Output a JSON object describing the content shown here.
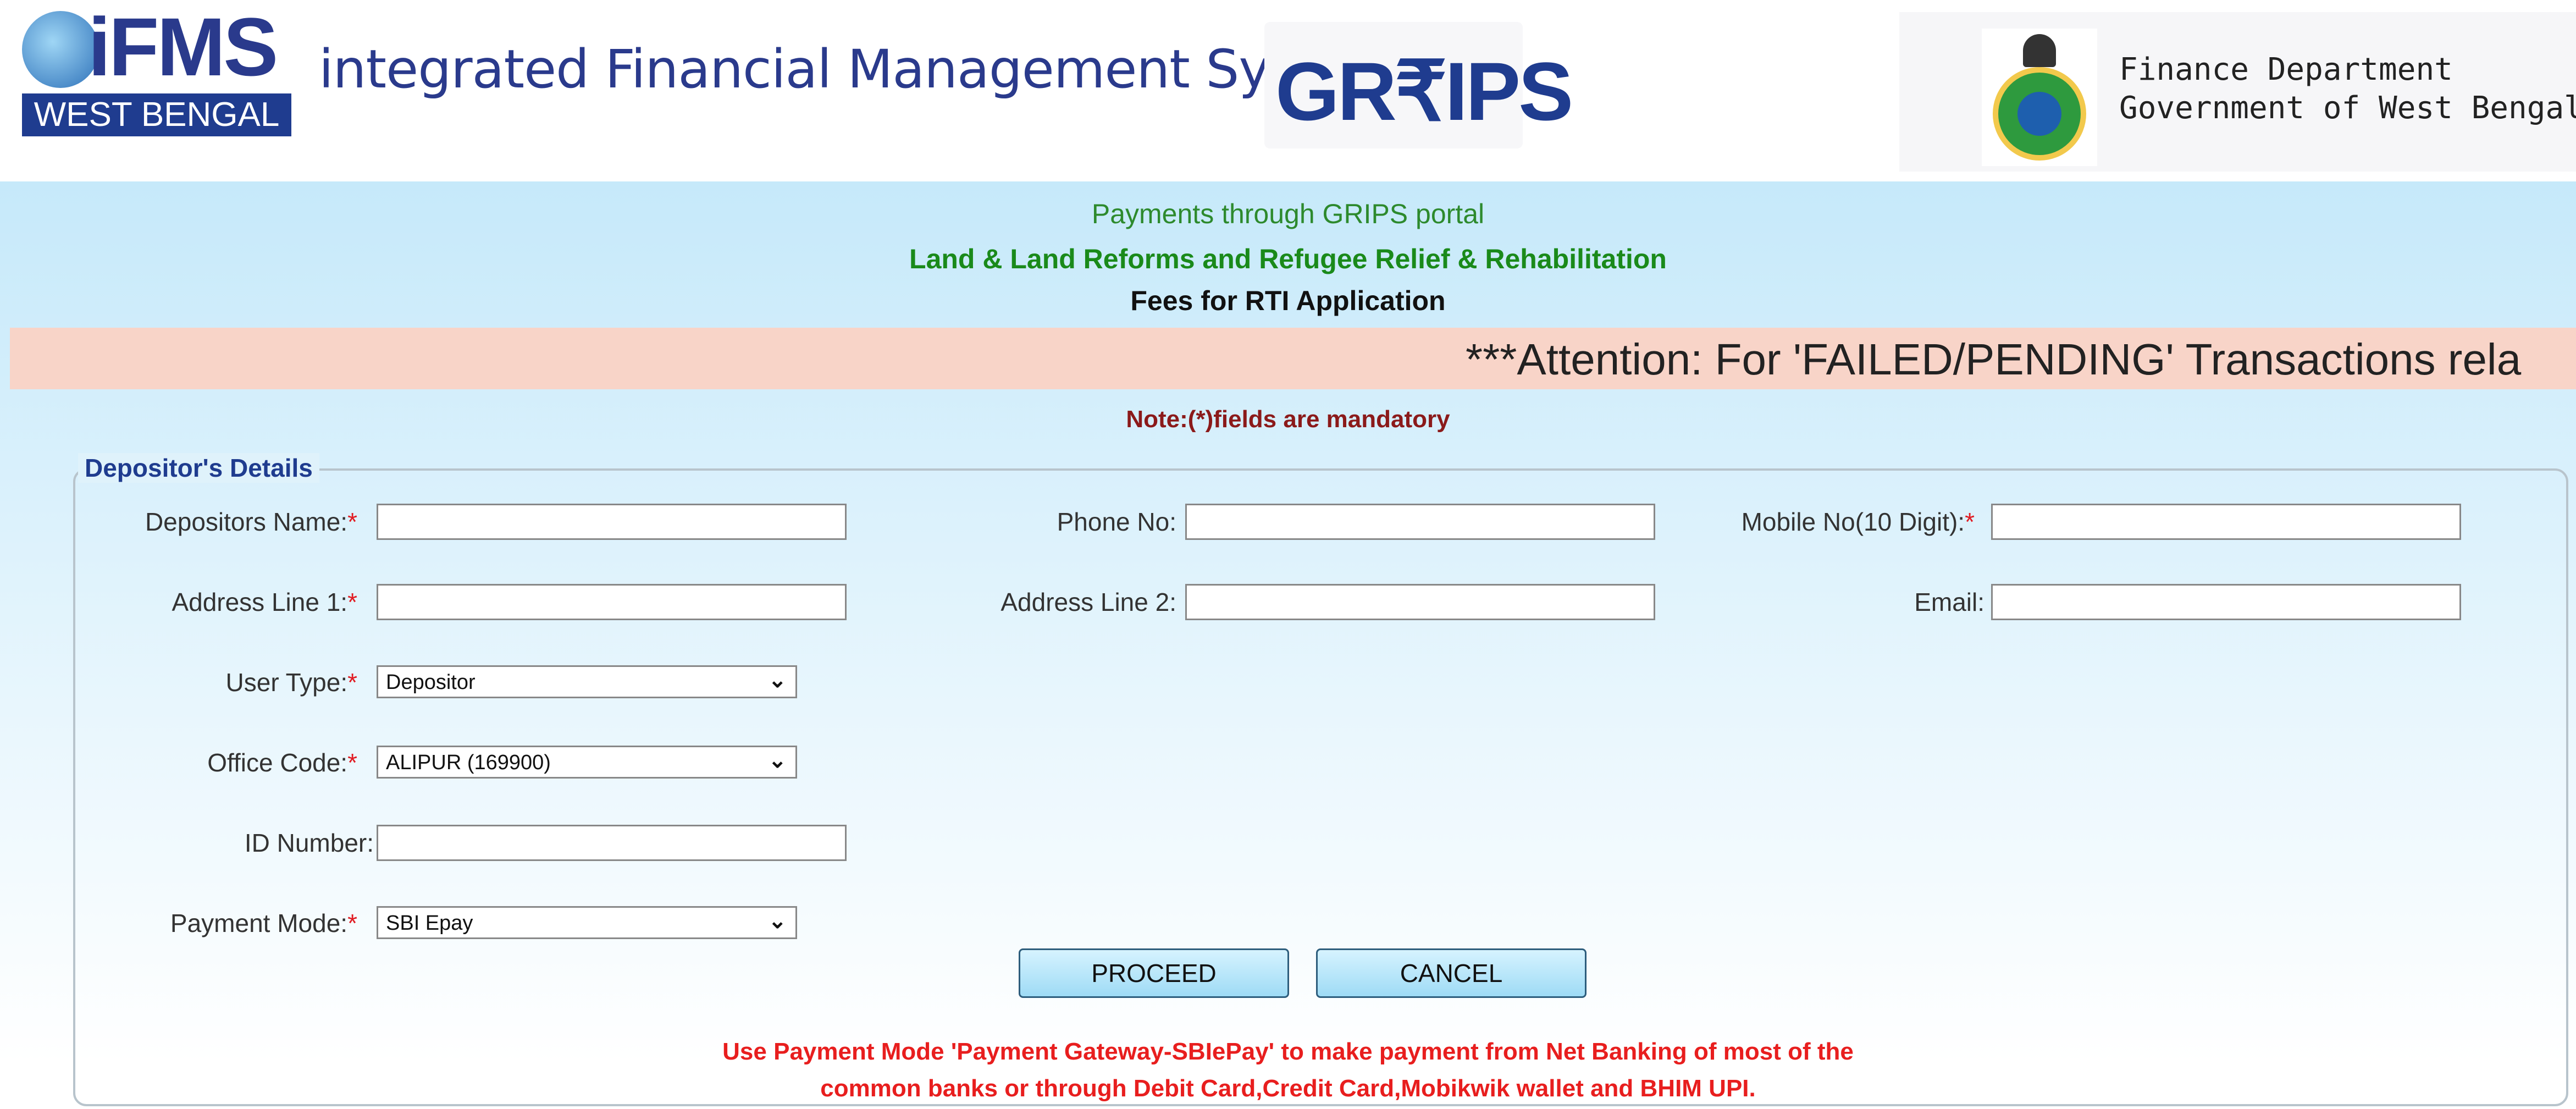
{
  "header": {
    "logo_text": "iFMS",
    "logo_region": "WEST BENGAL",
    "system_title": "integrated Financial Management System",
    "grips_logo": "GR₹IPS",
    "dept_line1": "Finance Department",
    "dept_line2": "Government of West Bengal"
  },
  "portal": {
    "line1": "Payments through GRIPS portal",
    "line2": "Land & Land Reforms and Refugee Relief & Rehabilitation",
    "line3": "Fees for RTI Application",
    "attention": "***Attention: For 'FAILED/PENDING' Transactions rela",
    "note": "Note:(*)fields are mandatory"
  },
  "form": {
    "legend": "Depositor's Details",
    "depositors_name_label": "Depositors Name:",
    "phone_label": "Phone No:",
    "mobile_label": "Mobile No(10 Digit):",
    "address1_label": "Address Line 1:",
    "address2_label": "Address Line 2:",
    "email_label": "Email:",
    "user_type_label": "User Type:",
    "user_type_value": "Depositor",
    "office_code_label": "Office Code:",
    "office_code_value": "ALIPUR (169900)",
    "id_number_label": "ID Number:",
    "payment_mode_label": "Payment Mode:",
    "payment_mode_value": "SBI Epay",
    "required_mark": "*"
  },
  "buttons": {
    "proceed": "PROCEED",
    "cancel": "CANCEL"
  },
  "info": {
    "line1": "Use Payment Mode 'Payment Gateway-SBIePay' to make payment from Net Banking of most of the",
    "line2": "common banks or through Debit Card,Credit Card,Mobikwik wallet and BHIM UPI."
  },
  "icons": [
    "dropdown-chevron-icon",
    "globe-icon",
    "state-emblem-icon"
  ]
}
